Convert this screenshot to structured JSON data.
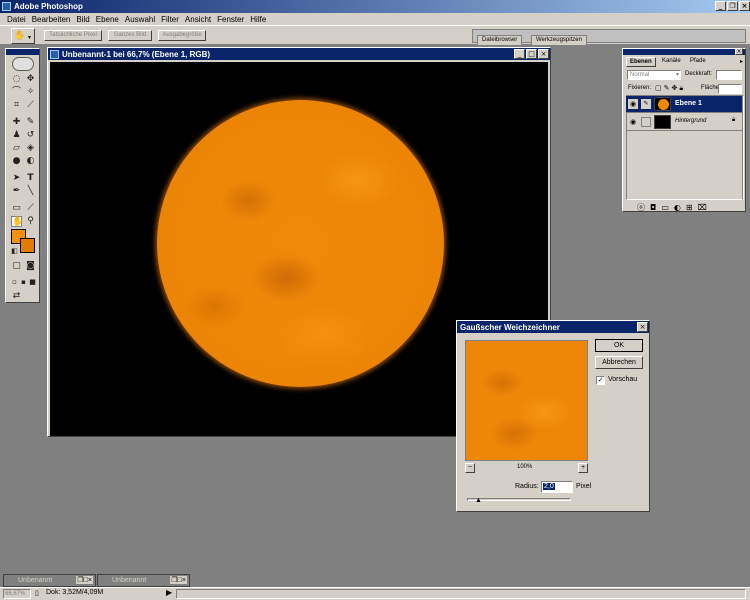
{
  "app": {
    "title": "Adobe Photoshop"
  },
  "menu": [
    "Datei",
    "Bearbeiten",
    "Bild",
    "Ebene",
    "Auswahl",
    "Filter",
    "Ansicht",
    "Fenster",
    "Hilfe"
  ],
  "options_bar": {
    "buttons": [
      "Tatsächliche Pixel",
      "Ganzes Bild",
      "Ausgabegröße"
    ],
    "well_tabs": [
      "Dateibrowser",
      "Werkzeugspitzen"
    ]
  },
  "document": {
    "title": "Unbenannt-1 bei 66,7% (Ebene 1, RGB)"
  },
  "layers_palette": {
    "tabs": [
      "Ebenen",
      "Kanäle",
      "Pfade"
    ],
    "blend_mode": "Normal",
    "opacity_label": "Deckkraft:",
    "fix_label": "Fixieren:",
    "fill_label": "Fläche",
    "layers": [
      {
        "name": "Ebene 1",
        "selected": true,
        "thumb_color": "#f0880a"
      },
      {
        "name": "Hintergrund",
        "selected": false,
        "thumb_color": "#000000"
      }
    ]
  },
  "gauss_dialog": {
    "title": "Gaußscher Weichzeichner",
    "ok": "OK",
    "cancel": "Abbrechen",
    "preview_label": "Vorschau",
    "preview_checked": true,
    "zoom": "100%",
    "zoom_out": "−",
    "zoom_in": "+",
    "radius_label": "Radius:",
    "radius_value": "2,0",
    "radius_unit": "Pixel"
  },
  "minimized_docs": [
    "Unbenannt",
    "Unbenannt"
  ],
  "status": {
    "zoom": "66,67%",
    "doc_info": "Dok: 3,52M/4,09M"
  },
  "colors": {
    "foreground": "#f5900a",
    "background": "#e07d00",
    "titlebar": "#0a246a"
  }
}
